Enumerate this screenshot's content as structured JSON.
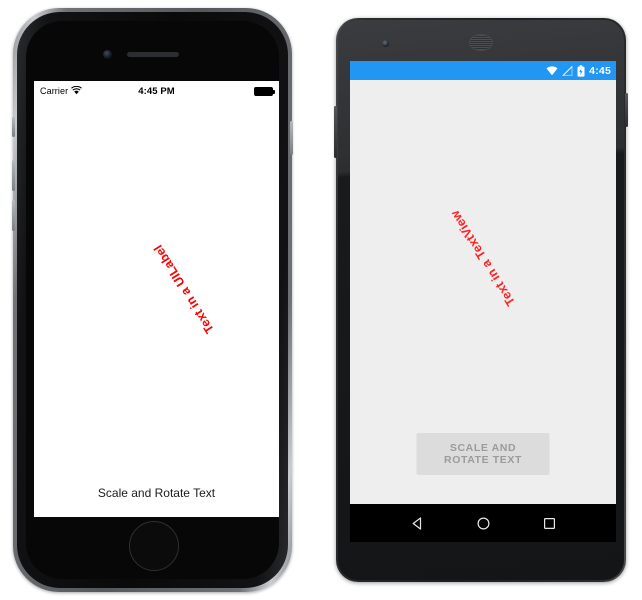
{
  "ios": {
    "status_bar": {
      "carrier": "Carrier",
      "wifi_icon": "wifi-icon",
      "time": "4:45 PM",
      "battery_icon": "battery-full-icon"
    },
    "rotated_label": {
      "text": "Text in a UILabel",
      "color": "#ff0000",
      "rotation_deg": 238
    },
    "button": {
      "label": "Scale and Rotate Text"
    },
    "screen_background": "#ffffff"
  },
  "android": {
    "status_bar": {
      "wifi_icon": "wifi-icon",
      "signal_icon": "signal-off-icon",
      "battery_icon": "battery-charging-icon",
      "time": "4:45",
      "background": "#2196f3"
    },
    "rotated_label": {
      "text": "Text in a TextView",
      "color": "#ff2222",
      "rotation_deg": 238
    },
    "button": {
      "label": "SCALE AND ROTATE TEXT",
      "background": "#dcdcdc",
      "text_color": "#9b9b9b"
    },
    "nav_bar": {
      "back_icon": "back-triangle-icon",
      "home_icon": "home-circle-icon",
      "recents_icon": "recents-square-icon"
    },
    "screen_background": "#eeeeee"
  }
}
